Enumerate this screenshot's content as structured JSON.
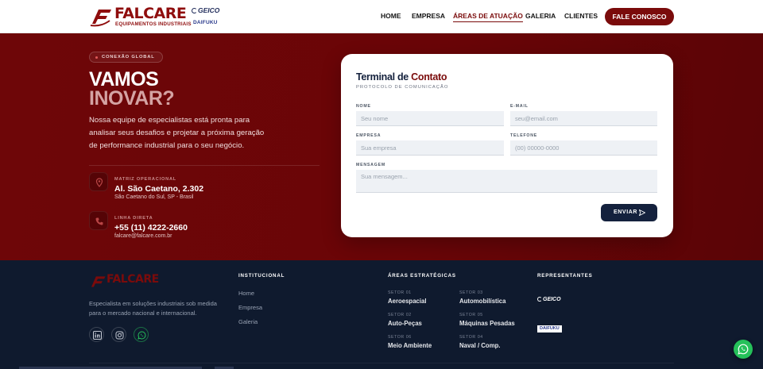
{
  "header": {
    "logo_text": "FALCARE",
    "logo_sub": "EQUIPAMENTOS INDUSTRIAIS",
    "partner_geico": "GEICO",
    "partner_daifuku": "DAIFUKU",
    "nav": [
      {
        "label": "HOME"
      },
      {
        "label": "EMPRESA"
      },
      {
        "label": "ÁREAS DE ATUAÇÃO"
      },
      {
        "label": "GALERIA"
      },
      {
        "label": "CLIENTES"
      }
    ],
    "cta_label": "FALE CONOSCO"
  },
  "hero": {
    "pill": "CONEXÃO GLOBAL",
    "title_line1": "VAMOS",
    "title_line2": "INOVAR?",
    "lead": "Nossa equipe de especialistas está pronta para analisar seus desafios e projetar a próxima geração de performance industrial para o seu negócio.",
    "address": {
      "label": "MATRIZ OPERACIONAL",
      "main": "Al. São Caetano, 2.302",
      "sub": "São Caetano do Sul, SP - Brasil"
    },
    "phone": {
      "label": "LINHA DIRETA",
      "main": "+55 (11) 4222-2660",
      "sub": "falcare@falcare.com.br"
    }
  },
  "form": {
    "title_plain": "Terminal de",
    "title_accent": "Contato",
    "subtitle": "PROTOCOLO DE COMUNICAÇÃO",
    "fields": {
      "nome": {
        "label": "NOME",
        "placeholder": "Seu nome"
      },
      "email": {
        "label": "E-MAIL",
        "placeholder": "seu@email.com"
      },
      "empresa": {
        "label": "EMPRESA",
        "placeholder": "Sua empresa"
      },
      "telefone": {
        "label": "TELEFONE",
        "placeholder": "(00) 00000-0000"
      },
      "mensagem": {
        "label": "MENSAGEM",
        "placeholder": "Sua mensagem..."
      }
    },
    "submit_label": "ENVIAR"
  },
  "footer": {
    "logo_text": "FALCARE",
    "description": "Especialista em soluções industriais sob medida para o mercado nacional e internacional.",
    "institucional": {
      "heading": "INSTITUCIONAL",
      "links": [
        "Home",
        "Empresa",
        "Galeria"
      ]
    },
    "areas": {
      "heading": "ÁREAS ESTRATÉGICAS",
      "sectors": [
        {
          "n": "SETOR 01",
          "t": "Aeroespacial"
        },
        {
          "n": "SETOR 02",
          "t": "Auto-Peças"
        },
        {
          "n": "SETOR 06",
          "t": "Meio Ambiente"
        },
        {
          "n": "SETOR 03",
          "t": "Automobilística"
        },
        {
          "n": "SETOR 05",
          "t": "Máquinas Pesadas"
        },
        {
          "n": "SETOR 04",
          "t": "Naval / Comp."
        }
      ]
    },
    "representantes": {
      "heading": "REPRESENTANTES",
      "geico": "GEICO",
      "daifuku": "DAIFUKU"
    }
  },
  "colors": {
    "brand_red": "#7a0b0b",
    "navy": "#14213d",
    "footer_bg": "#0f1a2e",
    "whatsapp": "#25c15a"
  },
  "icons": [
    "location-pin-icon",
    "phone-icon",
    "send-icon",
    "linkedin-icon",
    "instagram-icon",
    "whatsapp-icon"
  ]
}
